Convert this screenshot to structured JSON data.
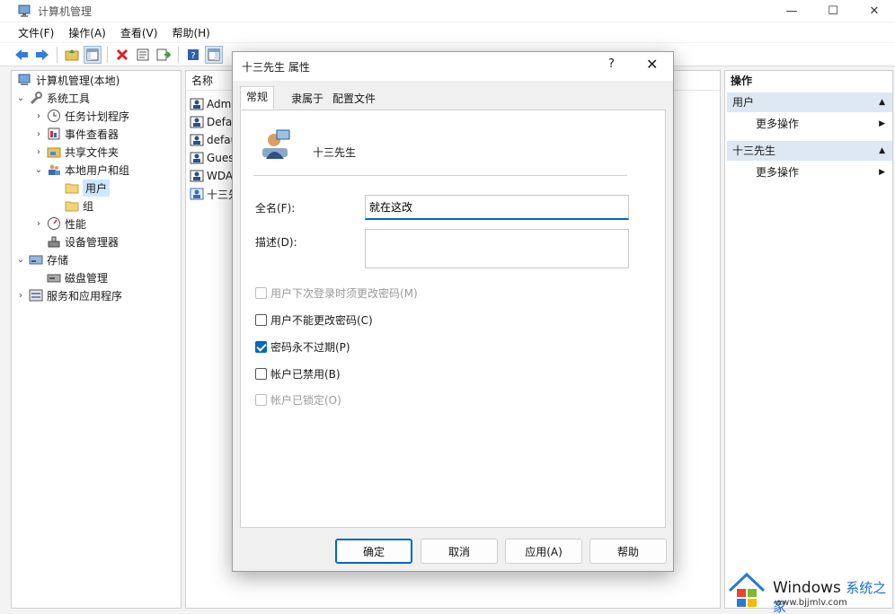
{
  "window": {
    "title": "计算机管理",
    "minimize": "—",
    "maximize": "☐",
    "close": "✕"
  },
  "menu": [
    "文件(F)",
    "操作(A)",
    "查看(V)",
    "帮助(H)"
  ],
  "tree": [
    {
      "label": "计算机管理(本地)",
      "icon": "computer-icon"
    },
    {
      "label": "系统工具",
      "icon": "tools-icon"
    },
    {
      "label": "任务计划程序",
      "icon": "clock-icon"
    },
    {
      "label": "事件查看器",
      "icon": "event-viewer-icon"
    },
    {
      "label": "共享文件夹",
      "icon": "shared-folder-icon"
    },
    {
      "label": "本地用户和组",
      "icon": "users-group-icon"
    },
    {
      "label": "用户",
      "icon": "folder-icon"
    },
    {
      "label": "组",
      "icon": "folder-icon"
    },
    {
      "label": "性能",
      "icon": "performance-icon"
    },
    {
      "label": "设备管理器",
      "icon": "device-manager-icon"
    },
    {
      "label": "存储",
      "icon": "storage-icon"
    },
    {
      "label": "磁盘管理",
      "icon": "disk-icon"
    },
    {
      "label": "服务和应用程序",
      "icon": "services-icon"
    }
  ],
  "list": {
    "header": "名称",
    "rows": [
      "Admi",
      "Defau",
      "defau",
      "Gues",
      "WDA",
      "十三先"
    ]
  },
  "actions": {
    "header": "操作",
    "sections": [
      {
        "title": "用户",
        "item": "更多操作"
      },
      {
        "title": "十三先生",
        "item": "更多操作"
      }
    ]
  },
  "dialog": {
    "title": "十三先生 属性",
    "help": "?",
    "close": "✕",
    "tabs": [
      "常规",
      "隶属于",
      "配置文件"
    ],
    "username": "十三先生",
    "fullname_label": "全名(F):",
    "fullname_value": "就在这改",
    "description_label": "描述(D):",
    "description_value": "",
    "checks": [
      {
        "label": "用户下次登录时须更改密码(M)",
        "state": "disabled"
      },
      {
        "label": "用户不能更改密码(C)",
        "state": "unchecked"
      },
      {
        "label": "密码永不过期(P)",
        "state": "checked"
      },
      {
        "label": "帐户已禁用(B)",
        "state": "unchecked"
      },
      {
        "label": "帐户已锁定(O)",
        "state": "disabled"
      }
    ],
    "buttons": {
      "ok": "确定",
      "cancel": "取消",
      "apply": "应用(A)",
      "help": "帮助"
    }
  },
  "watermark": {
    "brand": "Windows",
    "brand_cn": "系统之家",
    "url": "www.bjjmlv.com"
  },
  "colors": {
    "accent": "#0067c0",
    "selection": "#cce8ff",
    "section_bg": "#dde8f3"
  }
}
